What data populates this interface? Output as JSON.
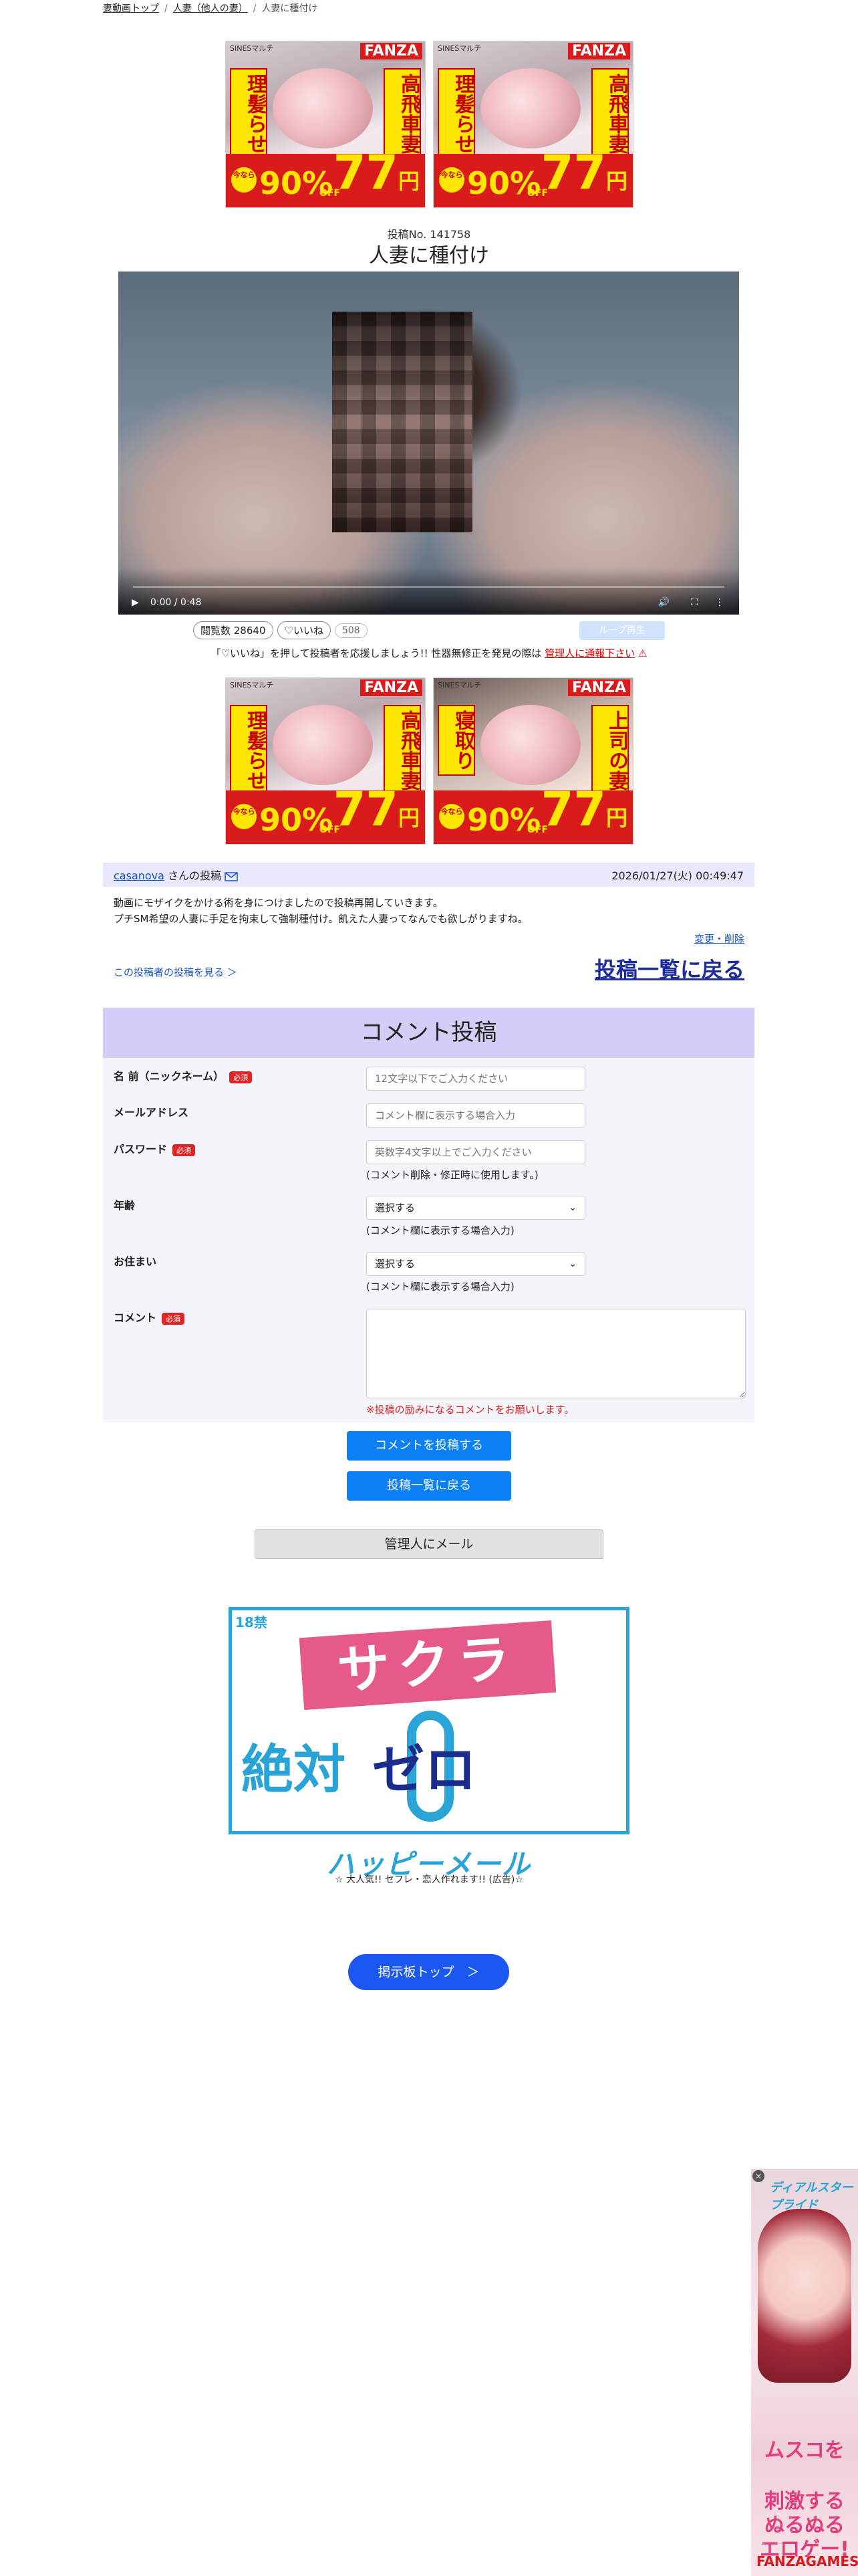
{
  "breadcrumb": {
    "home": "妻動画トップ",
    "category": "人妻（他人の妻）",
    "current": "人妻に種付け"
  },
  "banner": {
    "brand": "SINESマルチ",
    "fanza": "FANZA",
    "copy_left_1": "理髪らせ",
    "copy_right_1": "高飛車妻",
    "copy_left_2": "理髪らせ",
    "copy_right_2": "高飛車妻",
    "copy_left_3": "理髪らせ",
    "copy_right_3": "高飛車妻",
    "copy_left_4": "寝取り",
    "copy_right_4": "上司の妻",
    "now": "今なら",
    "percent": "90%",
    "off": "OFF",
    "price": "77",
    "yen": "円"
  },
  "post": {
    "number": "投稿No. 141758",
    "title": "人妻に種付け"
  },
  "video": {
    "time": "0:00 / 0:48",
    "progress_percent": 0,
    "play_icon": "▶",
    "volume_icon": "🔊",
    "fullscreen_icon": "⛶",
    "more_icon": "⋮"
  },
  "stats": {
    "views": "閲覧数 28640",
    "like": "♡いいね",
    "like_count": "508",
    "loop": "ループ再生"
  },
  "notice": {
    "text": "「♡いいね」を押して投稿者を応援しましょう!! 性器無修正を発見の際は",
    "link": "管理人に通報下さい",
    "warn_icon": "⚠"
  },
  "post_detail": {
    "author": "casanova",
    "author_suffix": "さんの投稿",
    "datetime": "2026/01/27(火) 00:49:47",
    "body_line1": "動画にモザイクをかける術を身につけましたので投稿再開していきます。",
    "body_line2": "プチSM希望の人妻に手足を拘束して強制種付け。飢えた人妻ってなんでも欲しがりますね。",
    "edit_link": "変更・削除",
    "author_posts_link": "この投稿者の投稿を見る ＞",
    "back_to_list": "投稿一覧に戻る"
  },
  "form": {
    "title": "コメント投稿",
    "required": "必須",
    "name_label": "名 前（ニックネーム）",
    "name_placeholder": "12文字以下でご入力ください",
    "email_label": "メールアドレス",
    "email_placeholder": "コメント欄に表示する場合入力",
    "password_label": "パスワード",
    "password_placeholder": "英数字4文字以上でご入力ください",
    "password_hint": "(コメント削除・修正時に使用します。)",
    "age_label": "年齢",
    "age_value": "選択する",
    "age_hint": "(コメント欄に表示する場合入力)",
    "area_label": "お住まい",
    "area_value": "選択する",
    "area_hint": "(コメント欄に表示する場合入力)",
    "comment_label": "コメント",
    "warning": "※投稿の励みになるコメントをお願いします。",
    "submit": "コメントを投稿する",
    "back": "投稿一覧に戻る"
  },
  "admin_mail": "管理人にメール",
  "ad": {
    "age": "18禁",
    "sakura": "サクラ",
    "zettai": "絶対",
    "zero": "ゼロ",
    "brand": "ハッピーメール",
    "caption": "☆ 大人気!! セフレ・恋人作れます!! (広告)☆"
  },
  "board_top": "掲示板トップ　＞",
  "side_ad": {
    "close": "×",
    "title": "ディアルスタープライド",
    "copy1": "ムスコを",
    "copy2": "刺激するぬるぬるエロゲー!",
    "brand": "FANZAGAMES"
  },
  "colors": {
    "link": "#1a55c4",
    "accent_blue": "#0b7ff5",
    "form_header": "#d5cdf8",
    "warn_red": "#d22222"
  }
}
